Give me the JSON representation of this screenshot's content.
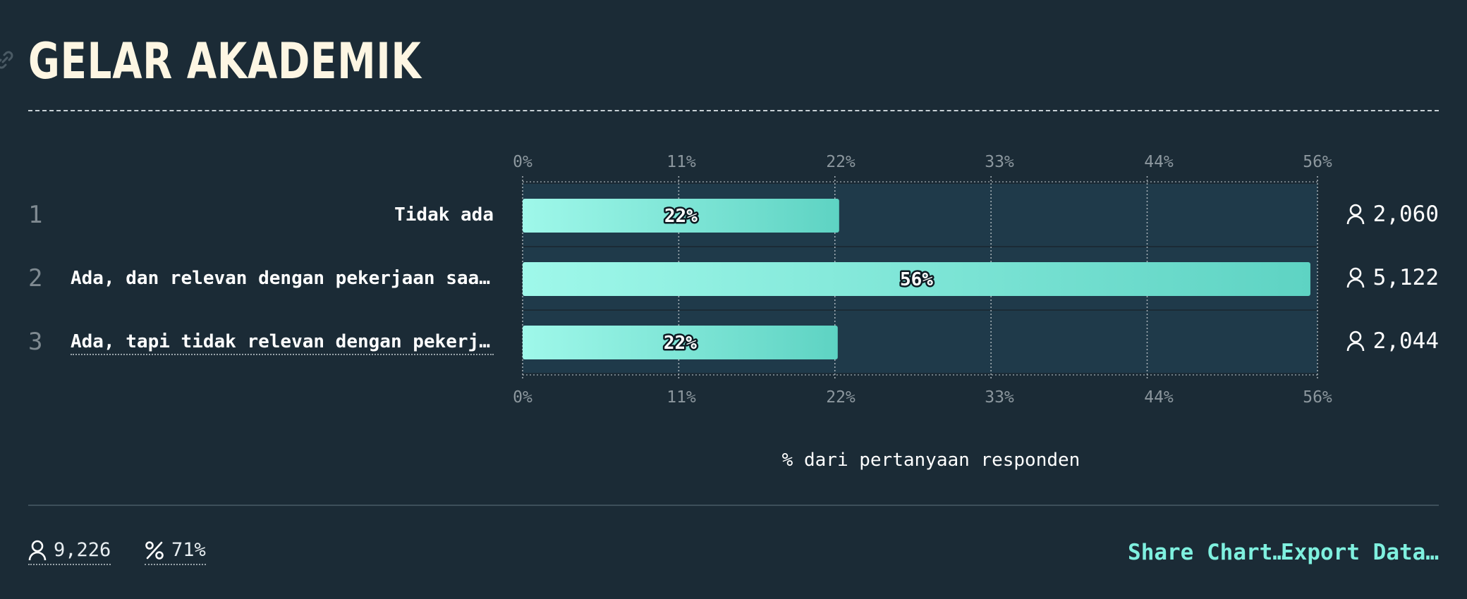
{
  "title": "GELAR AKADEMIK",
  "icons": {
    "link": "link-icon",
    "person": "person-icon",
    "percent": "percent-icon"
  },
  "colors": {
    "background": "#1b2b36",
    "track": "#1f3a4a",
    "bar_start": "#9ff8ea",
    "bar_end": "#5ed3c3",
    "accent": "#7ff0df"
  },
  "chart_data": {
    "type": "bar",
    "orientation": "horizontal",
    "xlabel": "% dari pertanyaan responden",
    "xlim": [
      0,
      56
    ],
    "ticks": [
      "0%",
      "11%",
      "22%",
      "33%",
      "44%",
      "56%"
    ],
    "tick_values": [
      0,
      11,
      22,
      33,
      44,
      56
    ],
    "grid": true,
    "categories": [
      "Tidak ada",
      "Ada, dan relevan dengan pekerjaan saat…",
      "Ada, tapi tidak relevan dengan pekerja…"
    ],
    "values": [
      22.3,
      55.5,
      22.2
    ],
    "value_labels": [
      "22%",
      "56%",
      "22%"
    ],
    "counts": [
      "2,060",
      "5,122",
      "2,044"
    ],
    "row_numbers": [
      "1",
      "2",
      "3"
    ]
  },
  "footer": {
    "respondents": "9,226",
    "response_rate": "71%",
    "share_label": "Share Chart…",
    "export_label": "Export Data…"
  }
}
